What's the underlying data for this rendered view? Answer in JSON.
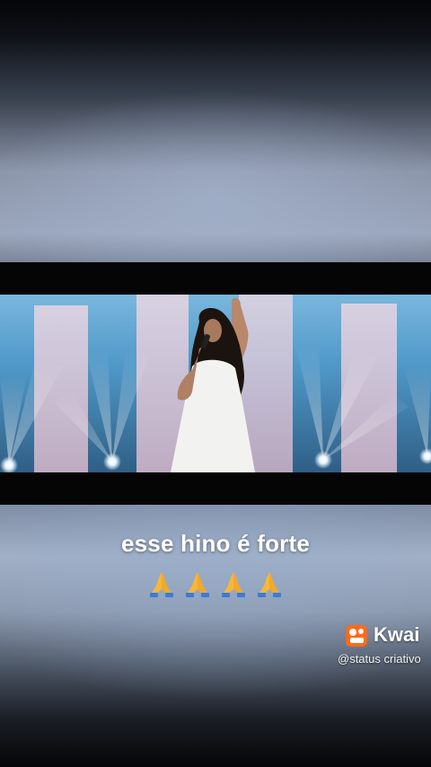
{
  "caption": {
    "text": "esse hino é forte"
  },
  "emojis": [
    {
      "icon": "praying-hands-icon"
    },
    {
      "icon": "praying-hands-icon"
    },
    {
      "icon": "praying-hands-icon"
    },
    {
      "icon": "praying-hands-icon"
    }
  ],
  "watermark": {
    "brand": "Kwai",
    "username": "@status criativo",
    "brand_color": "#ff6a1a"
  },
  "video": {
    "content": "singer-on-stage",
    "stage_color": "#5aa6d6",
    "dress_color": "#f2f2f0"
  }
}
